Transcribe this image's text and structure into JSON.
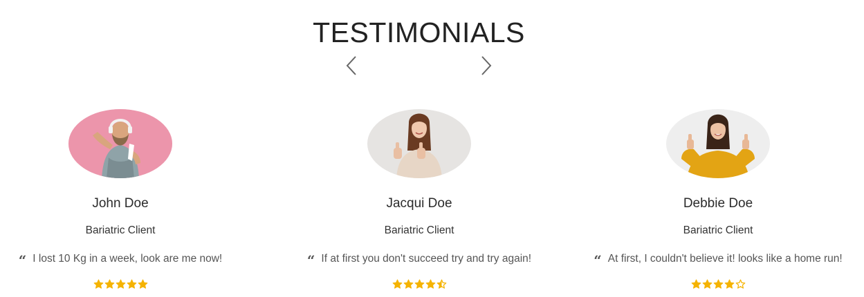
{
  "section": {
    "title": "TESTIMONIALS",
    "prev_icon": "chevron-left-icon",
    "next_icon": "chevron-right-icon"
  },
  "colors": {
    "star": "#f5b301",
    "text": "#2b2b2b",
    "muted": "#555555"
  },
  "testimonials": [
    {
      "name": "John Doe",
      "role": "Bariatric Client",
      "quote": "I lost 10 Kg in a week, look are me now!",
      "rating": 5,
      "photo": "man-with-headphones-pink-background"
    },
    {
      "name": "Jacqui Doe",
      "role": "Bariatric Client",
      "quote": "If at first you don't succeed try and try again!",
      "rating": 4.5,
      "photo": "woman-thumbs-up-beige-sweater"
    },
    {
      "name": "Debbie Doe",
      "role": "Bariatric Client",
      "quote": "At first, I couldn't believe it! looks like a home run!",
      "rating": 4,
      "photo": "woman-thumbs-up-yellow-shirt"
    }
  ]
}
